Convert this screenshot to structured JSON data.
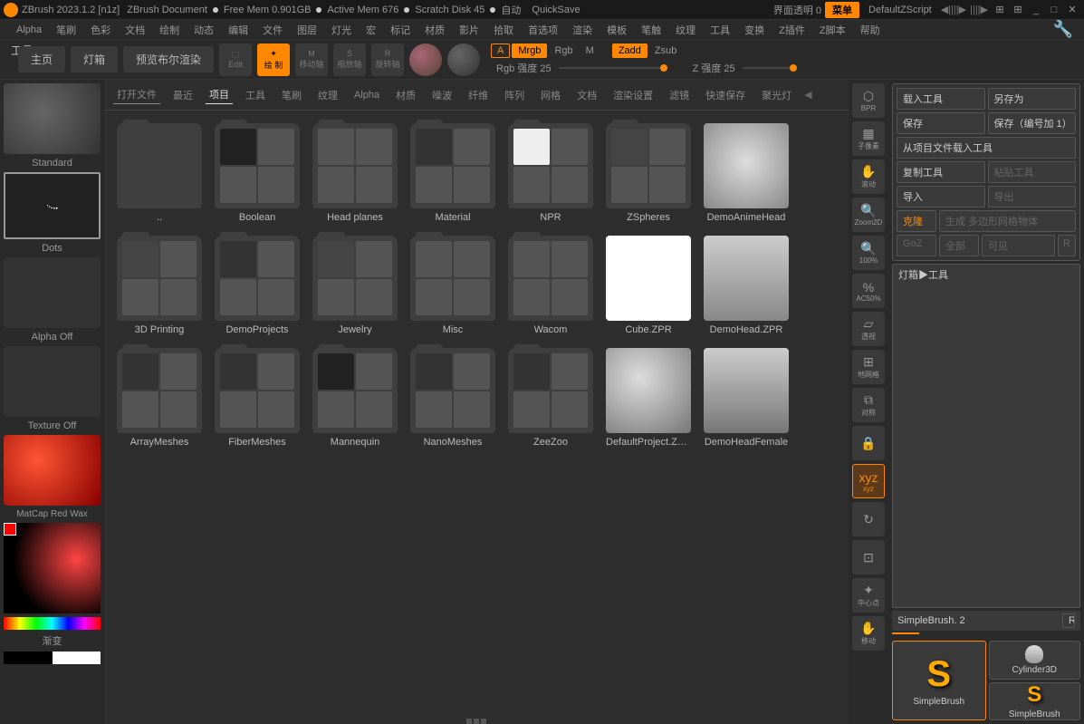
{
  "title_bar": {
    "app": "ZBrush 2023.1.2 [n1z]",
    "doc": "ZBrush Document",
    "free_mem": "Free Mem 0.901GB",
    "active_mem": "Active Mem 676",
    "scratch": "Scratch Disk 45",
    "auto": "自动",
    "quicksave": "QuickSave",
    "ui_transparent": "界面透明 0",
    "menu": "菜单",
    "zscript": "DefaultZScript"
  },
  "menu": [
    "Alpha",
    "笔刷",
    "色彩",
    "文档",
    "绘制",
    "动态",
    "编辑",
    "文件",
    "图层",
    "灯光",
    "宏",
    "标记",
    "材质",
    "影片",
    "拾取",
    "首选项",
    "渲染",
    "模板",
    "笔触",
    "纹理",
    "工具",
    "变换",
    "Z插件",
    "Z脚本",
    "帮助"
  ],
  "toolbar": {
    "home": "主页",
    "lightbox": "灯箱",
    "preview": "预览布尔渲染",
    "edit": "Edit",
    "draw": "绘 制",
    "move": "移动轴",
    "scale": "缩放轴",
    "rotate": "旋转轴",
    "mode_a": "A",
    "mode_mrgb": "Mrgb",
    "mode_rgb": "Rgb",
    "mode_m": "M",
    "mode_zadd": "Zadd",
    "mode_zsub": "Zsub",
    "rgb_intensity": "Rgb 强度 25",
    "z_intensity": "Z 强度 25"
  },
  "left": {
    "brush": "Standard",
    "stroke": "Dots",
    "alpha": "Alpha Off",
    "texture": "Texture Off",
    "material": "MatCap Red Wax",
    "gradient": "渐变"
  },
  "browser": {
    "tabs": [
      "打开文件",
      "最近",
      "项目",
      "工具",
      "笔刷",
      "纹理",
      "Alpha",
      "材质",
      "噪波",
      "纤维",
      "阵列",
      "网格",
      "文档",
      "渲染设置",
      "滤镜",
      "快速保存",
      "聚光灯"
    ],
    "active_tab_index": 2,
    "items": [
      {
        "label": ".."
      },
      {
        "label": "Boolean"
      },
      {
        "label": "Head planes"
      },
      {
        "label": "Material"
      },
      {
        "label": "NPR"
      },
      {
        "label": "ZSpheres"
      },
      {
        "label": "DemoAnimeHead"
      },
      {
        "label": "3D Printing"
      },
      {
        "label": "DemoProjects"
      },
      {
        "label": "Jewelry"
      },
      {
        "label": "Misc"
      },
      {
        "label": "Wacom"
      },
      {
        "label": "Cube.ZPR"
      },
      {
        "label": "DemoHead.ZPR"
      },
      {
        "label": "ArrayMeshes"
      },
      {
        "label": "FiberMeshes"
      },
      {
        "label": "Mannequin"
      },
      {
        "label": "NanoMeshes"
      },
      {
        "label": "ZeeZoo"
      },
      {
        "label": "DefaultProject.ZPR"
      },
      {
        "label": "DemoHeadFemale"
      }
    ]
  },
  "side_icons": [
    "BPR",
    "子像素",
    "滚动",
    "Zoom2D",
    "100%",
    "AC50%",
    "透视",
    "地网格",
    "对称",
    "",
    "xyz",
    "",
    "",
    "中心点",
    "移动"
  ],
  "right_panel": {
    "title": "工具",
    "load_tool": "载入工具",
    "save_as": "另存为",
    "save": "保存",
    "save_inc": "保存（编号加 1）",
    "import_project": "从项目文件载入工具",
    "copy_tool": "复制工具",
    "paste_tool": "粘贴工具",
    "import": "导入",
    "export": "导出",
    "clone": "克隆",
    "make_polymesh": "生成 多边形网格物体",
    "goz": "GoZ",
    "all": "全部",
    "visible": "可见",
    "r": "R",
    "lightbox_tools": "灯箱▶工具",
    "tool_name": "SimpleBrush. 2",
    "r2": "R",
    "thumb1": "SimpleBrush",
    "thumb2": "Cylinder3D",
    "thumb3": "SimpleBrush"
  }
}
